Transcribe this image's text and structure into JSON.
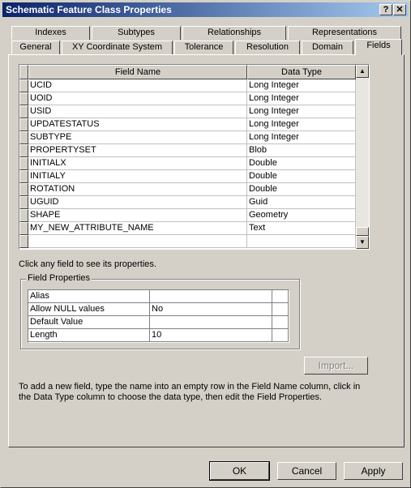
{
  "window": {
    "title": "Schematic Feature Class Properties",
    "help_glyph": "?",
    "close_glyph": "✕"
  },
  "tabs_back": [
    "Indexes",
    "Subtypes",
    "Relationships",
    "Representations"
  ],
  "tabs_front": [
    "General",
    "XY Coordinate System",
    "Tolerance",
    "Resolution",
    "Domain",
    "Fields"
  ],
  "grid": {
    "headers": [
      "Field Name",
      "Data Type"
    ],
    "rows": [
      [
        "UCID",
        "Long Integer"
      ],
      [
        "UOID",
        "Long Integer"
      ],
      [
        "USID",
        "Long Integer"
      ],
      [
        "UPDATESTATUS",
        "Long Integer"
      ],
      [
        "SUBTYPE",
        "Long Integer"
      ],
      [
        "PROPERTYSET",
        "Blob"
      ],
      [
        "INITIALX",
        "Double"
      ],
      [
        "INITIALY",
        "Double"
      ],
      [
        "ROTATION",
        "Double"
      ],
      [
        "UGUID",
        "Guid"
      ],
      [
        "SHAPE",
        "Geometry"
      ],
      [
        "MY_NEW_ATTRIBUTE_NAME",
        "Text"
      ],
      [
        "",
        ""
      ]
    ],
    "scroll_up": "▲",
    "scroll_down": "▼"
  },
  "hint": "Click any field to see its properties.",
  "field_properties": {
    "title": "Field Properties",
    "rows": [
      [
        "Alias",
        ""
      ],
      [
        "Allow NULL values",
        "No"
      ],
      [
        "Default Value",
        ""
      ],
      [
        "Length",
        "10"
      ]
    ]
  },
  "import_label": "Import...",
  "help_text": "To add a new field, type the name into an empty row in the Field Name column, click in the Data Type column to choose the data type, then edit the Field Properties.",
  "buttons": {
    "ok": "OK",
    "cancel": "Cancel",
    "apply": "Apply"
  }
}
